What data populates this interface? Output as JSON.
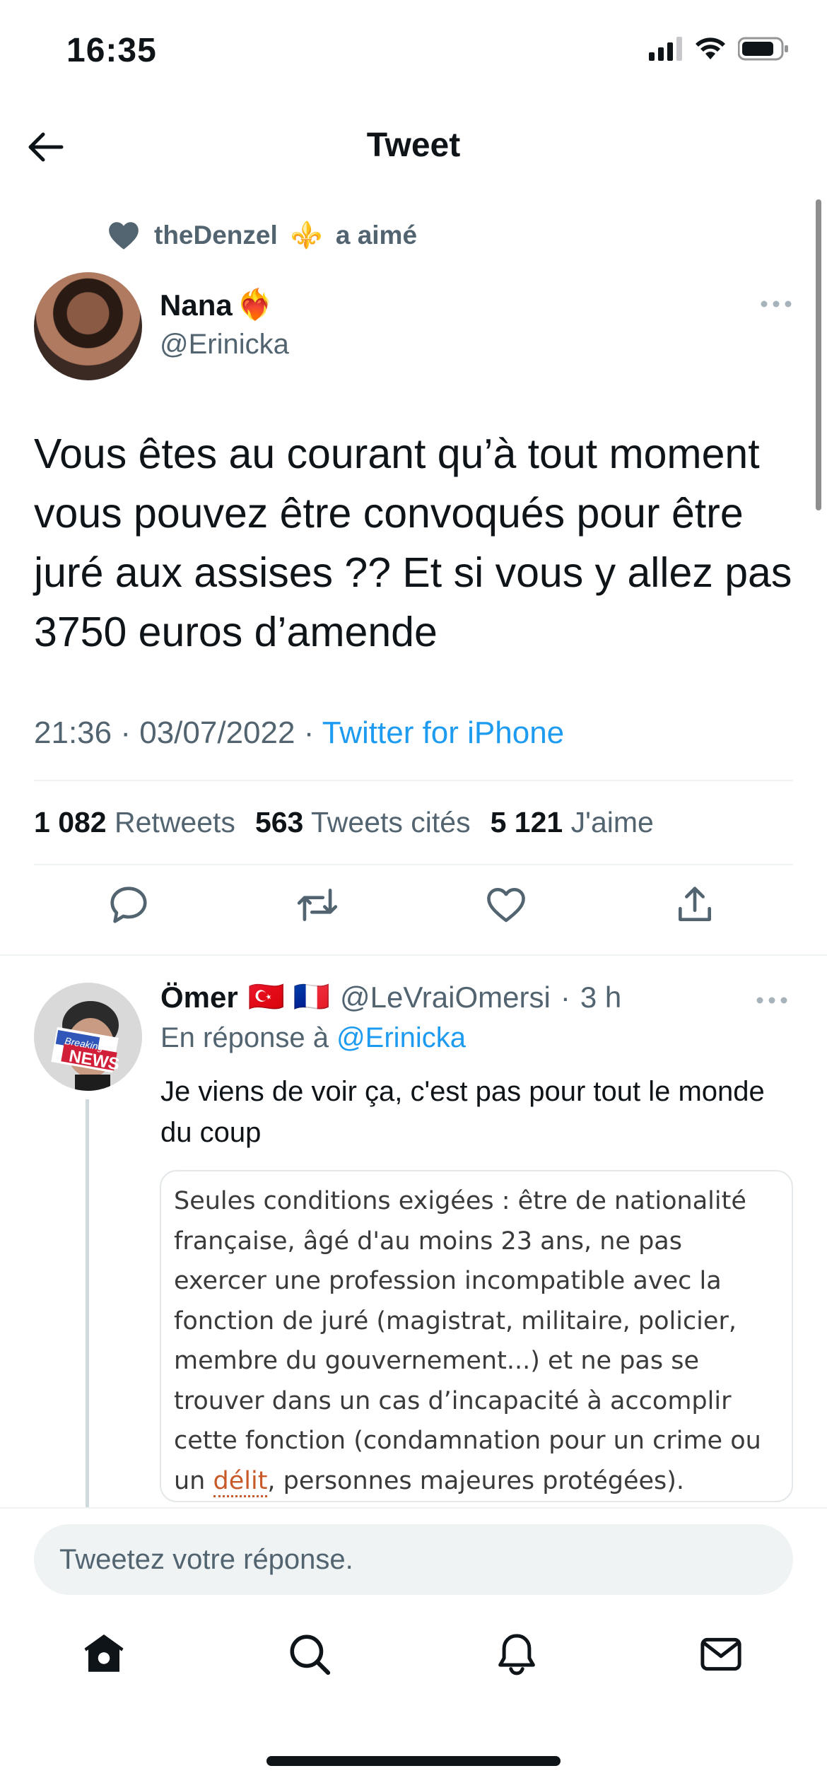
{
  "status_bar": {
    "time": "16:35",
    "signal_icon": "cellular-signal-icon",
    "wifi_icon": "wifi-icon",
    "battery_icon": "battery-icon"
  },
  "header": {
    "title": "Tweet",
    "back_icon": "arrow-left-icon"
  },
  "social_context": {
    "user": "theDenzel",
    "emoji": "⚜️",
    "action": "a aimé"
  },
  "tweet": {
    "name": "Nana",
    "name_emoji": "❤️‍🔥",
    "handle": "@Erinicka",
    "text": "Vous êtes au courant qu’à tout moment vous pouvez être convoqués pour être juré aux assises ?? Et si vous y allez pas 3750 euros d’amende",
    "time": "21:36",
    "date": "03/07/2022",
    "separator": "·",
    "source": "Twitter for iPhone",
    "stats": {
      "retweets_count": "1 082",
      "retweets_label": "Retweets",
      "quotes_count": "563",
      "quotes_label": "Tweets cités",
      "likes_count": "5 121",
      "likes_label": "J'aime"
    }
  },
  "reply": {
    "name": "Ömer",
    "flags": "🇹🇷 🇫🇷",
    "handle": "@LeVraiOmersi",
    "time": "3 h",
    "separator": "·",
    "reply_to_prefix": "En réponse à",
    "reply_to_handle": "@Erinicka",
    "text": "Je viens de voir ça, c'est pas pour tout le monde du coup",
    "image_text_before": "Seules conditions exigées : être de nationalité française, âgé d'au moins 23 ans, ne pas exercer une profession incompatible avec la fonction de juré (magistrat, militaire, policier, membre du gouvernement...) et ne pas se trouver dans un cas d’incapacité à accomplir cette fonction (condamnation pour un crime ou un ",
    "image_text_link": "délit",
    "image_text_after": ", personnes majeures protégées).",
    "avatar_overlay_top": "Breaking",
    "avatar_overlay_bottom": "NEWS"
  },
  "compose": {
    "placeholder": "Tweetez votre réponse."
  },
  "tabbar": {
    "items": [
      "home-icon",
      "search-icon",
      "notifications-icon",
      "messages-icon"
    ]
  },
  "colors": {
    "accent": "#1d9bf0",
    "text": "#0f1419",
    "muted": "#536471",
    "divider": "#eff3f4"
  }
}
